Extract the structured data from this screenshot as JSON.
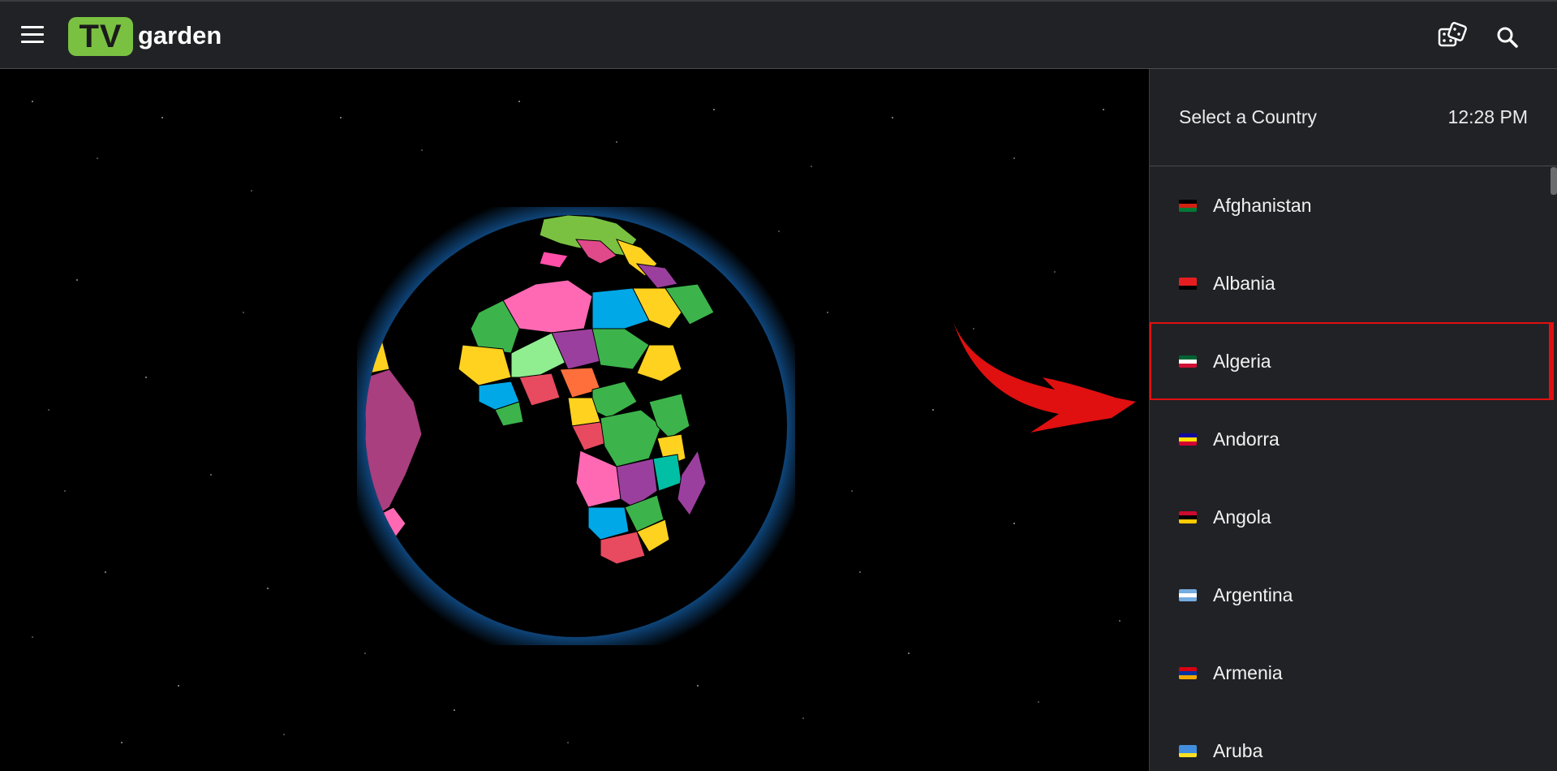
{
  "header": {
    "logo_tv": "TV",
    "logo_text": "garden",
    "menu_icon": "hamburger-menu-icon",
    "dice_icon": "dice-icon",
    "search_icon": "search-icon"
  },
  "panel": {
    "title": "Select a Country",
    "time": "12:28 PM",
    "countries": [
      {
        "name": "Afghanistan",
        "flag": "afghanistan-flag-icon",
        "colors": [
          "#000000",
          "#d32011",
          "#007a36"
        ],
        "selected": false
      },
      {
        "name": "Albania",
        "flag": "albania-flag-icon",
        "colors": [
          "#e41e20",
          "#e41e20",
          "#000000"
        ],
        "selected": false
      },
      {
        "name": "Algeria",
        "flag": "algeria-flag-icon",
        "colors": [
          "#006233",
          "#ffffff",
          "#d21034"
        ],
        "selected": true
      },
      {
        "name": "Andorra",
        "flag": "andorra-flag-icon",
        "colors": [
          "#10069f",
          "#fedf00",
          "#d50032"
        ],
        "selected": false
      },
      {
        "name": "Angola",
        "flag": "angola-flag-icon",
        "colors": [
          "#cc092f",
          "#000000",
          "#ffcb00"
        ],
        "selected": false
      },
      {
        "name": "Argentina",
        "flag": "argentina-flag-icon",
        "colors": [
          "#74acdf",
          "#ffffff",
          "#74acdf"
        ],
        "selected": false
      },
      {
        "name": "Armenia",
        "flag": "armenia-flag-icon",
        "colors": [
          "#d90012",
          "#0033a0",
          "#f2a800"
        ],
        "selected": false
      },
      {
        "name": "Aruba",
        "flag": "aruba-flag-icon",
        "colors": [
          "#418fde",
          "#418fde",
          "#fbe122"
        ],
        "selected": false
      }
    ]
  },
  "colors": {
    "accent_green": "#7ac142",
    "highlight_red": "#e01010",
    "panel_bg": "#212226"
  },
  "globe_icon": "earth-globe-icon",
  "arrow_icon": "red-arrow-icon"
}
